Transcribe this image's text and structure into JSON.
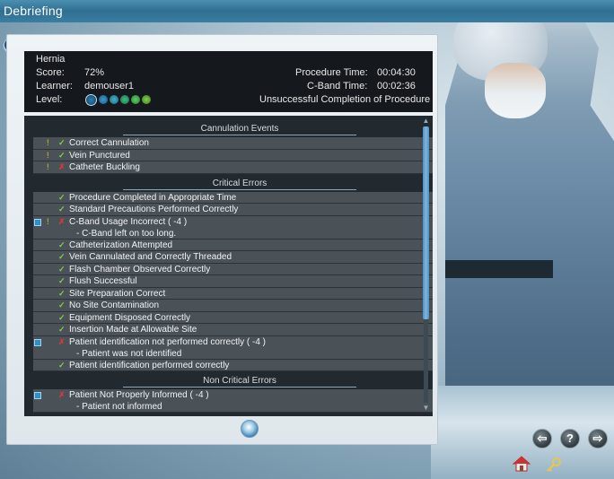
{
  "window": {
    "title": "Debriefing"
  },
  "header": {
    "procedure_name": "Hernia",
    "score_label": "Score:",
    "score_value": "72%",
    "learner_label": "Learner:",
    "learner_value": "demouser1",
    "level_label": "Level:",
    "procedure_time_label": "Procedure Time:",
    "procedure_time_value": "00:04:30",
    "cband_time_label": "C-Band Time:",
    "cband_time_value": "00:02:36",
    "completion_status": "Unsuccessful Completion of Procedure",
    "level_icons": [
      "level-1-icon",
      "level-2-icon",
      "level-3-icon",
      "level-4-icon",
      "level-5-icon",
      "level-6-icon"
    ]
  },
  "sections": [
    {
      "title": "Cannulation Events",
      "items": [
        {
          "text": "Correct Cannulation",
          "status": "ok",
          "alert": true
        },
        {
          "text": "Vein Punctured",
          "status": "ok",
          "alert": true
        },
        {
          "text": "Catheter Buckling",
          "status": "bad",
          "alert": true
        }
      ]
    },
    {
      "title": "Critical Errors",
      "items": [
        {
          "text": "Procedure Completed in Appropriate Time",
          "status": "ok"
        },
        {
          "text": "Standard Precautions Performed Correctly",
          "status": "ok"
        },
        {
          "text": "C-Band Usage Incorrect ( -4 )",
          "sub": "- C-Band left on too long.",
          "status": "bad",
          "alert": true,
          "collapse": true
        },
        {
          "text": "Catheterization Attempted",
          "status": "ok"
        },
        {
          "text": "Vein Cannulated and Correctly Threaded",
          "status": "ok"
        },
        {
          "text": "Flash Chamber Observed Correctly",
          "status": "ok"
        },
        {
          "text": "Flush Successful",
          "status": "ok"
        },
        {
          "text": "Site Preparation Correct",
          "status": "ok"
        },
        {
          "text": "No Site Contamination",
          "status": "ok"
        },
        {
          "text": "Equipment Disposed Correctly",
          "status": "ok"
        },
        {
          "text": "Insertion Made at Allowable Site",
          "status": "ok"
        },
        {
          "text": "Patient identification not performed correctly ( -4 )",
          "sub": "- Patient was not identified",
          "status": "bad",
          "collapse": true
        },
        {
          "text": "Patient identification performed correctly",
          "status": "ok"
        }
      ]
    },
    {
      "title": "Non Critical Errors",
      "items": [
        {
          "text": "Patient Not Properly Informed ( -4 )",
          "sub": "- Patient not informed",
          "status": "bad",
          "collapse": true
        }
      ]
    }
  ],
  "icons": {
    "ok": "✓",
    "bad": "✗",
    "alert": "!",
    "back": "⇦",
    "help": "?",
    "forward": "⇨"
  },
  "colors": {
    "ok": "#7fd04a",
    "bad": "#d23b3b",
    "accent": "#2f6f92"
  }
}
